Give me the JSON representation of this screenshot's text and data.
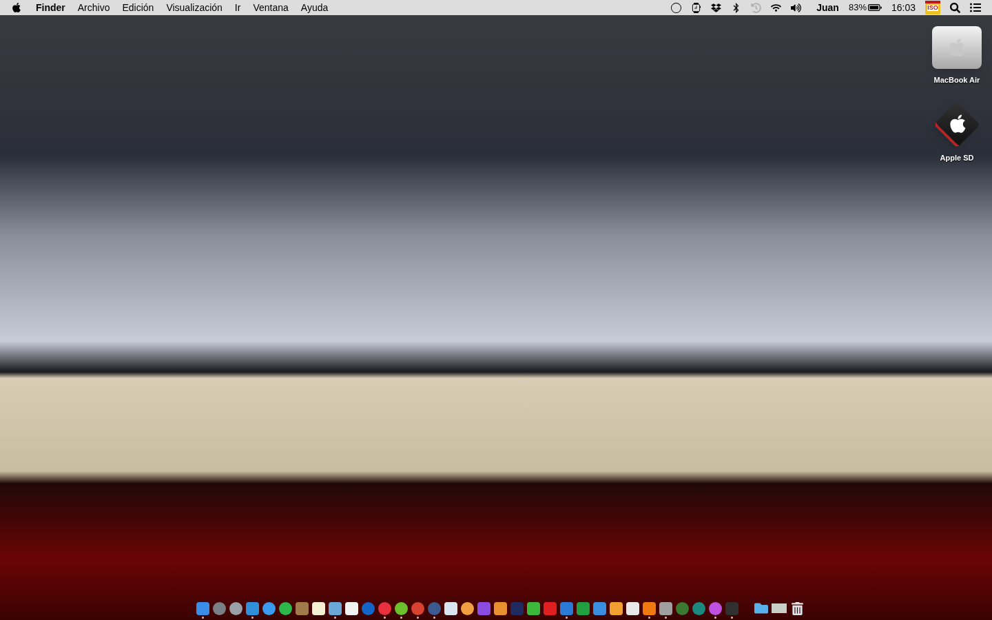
{
  "menu_bar": {
    "app_name": "Finder",
    "menus": [
      "Archivo",
      "Edición",
      "Visualización",
      "Ir",
      "Ventana",
      "Ayuda"
    ],
    "status_items": [
      {
        "kind": "circle",
        "dimmed": false
      },
      {
        "kind": "watch",
        "dimmed": false
      },
      {
        "kind": "dropbox",
        "dimmed": false
      },
      {
        "kind": "bluetooth",
        "dimmed": false
      },
      {
        "kind": "history",
        "dimmed": true
      },
      {
        "kind": "wifi",
        "dimmed": false
      },
      {
        "kind": "volume",
        "dimmed": false
      }
    ],
    "user": "Juan",
    "battery_percent": "83%",
    "clock": "16:03",
    "input_source": "ISO"
  },
  "desktop_icons": [
    {
      "kind": "drive",
      "label": "MacBook Air"
    },
    {
      "kind": "sd",
      "label": "Apple SD"
    }
  ],
  "dock": {
    "apps": [
      {
        "kind": "square",
        "color": "#3b8ee8",
        "running": true
      },
      {
        "kind": "circle",
        "color": "#7a7f85",
        "running": false
      },
      {
        "kind": "circle",
        "color": "#9aa0a8",
        "running": false
      },
      {
        "kind": "square",
        "color": "#2f8fd8",
        "running": true
      },
      {
        "kind": "circle",
        "color": "#3a9af0",
        "running": false
      },
      {
        "kind": "circle",
        "color": "#2cb84a",
        "running": false
      },
      {
        "kind": "square",
        "color": "#a07a48",
        "running": false
      },
      {
        "kind": "square",
        "color": "#f4efd0",
        "running": false
      },
      {
        "kind": "square",
        "color": "#6aa8d8",
        "running": true
      },
      {
        "kind": "square",
        "color": "#f2f2f2",
        "running": false
      },
      {
        "kind": "circle",
        "color": "#1465c8",
        "running": false
      },
      {
        "kind": "circle",
        "color": "#e8303e",
        "running": true
      },
      {
        "kind": "circle",
        "color": "#6cc02c",
        "running": true
      },
      {
        "kind": "circle",
        "color": "#d84030",
        "running": true
      },
      {
        "kind": "circle",
        "color": "#3b5a90",
        "running": true
      },
      {
        "kind": "square",
        "color": "#d8e4f0",
        "running": false
      },
      {
        "kind": "circle",
        "color": "#f0a040",
        "running": false
      },
      {
        "kind": "square",
        "color": "#8a4ce0",
        "running": false
      },
      {
        "kind": "square",
        "color": "#e89030",
        "running": false
      },
      {
        "kind": "square",
        "color": "#1e2a60",
        "running": false
      },
      {
        "kind": "square",
        "color": "#3cb83c",
        "running": false
      },
      {
        "kind": "square",
        "color": "#e02020",
        "running": false
      },
      {
        "kind": "square",
        "color": "#2a7ad8",
        "running": true
      },
      {
        "kind": "square",
        "color": "#20a040",
        "running": false
      },
      {
        "kind": "square",
        "color": "#3a8ee0",
        "running": false
      },
      {
        "kind": "square",
        "color": "#f0a030",
        "running": false
      },
      {
        "kind": "square",
        "color": "#e8e8e8",
        "running": false
      },
      {
        "kind": "square",
        "color": "#f07a10",
        "running": true
      },
      {
        "kind": "square",
        "color": "#a0a0a0",
        "running": true
      },
      {
        "kind": "circle",
        "color": "#3a7a30",
        "running": false
      },
      {
        "kind": "circle",
        "color": "#1a8a80",
        "running": false
      },
      {
        "kind": "circle",
        "color": "#c050e0",
        "running": true
      },
      {
        "kind": "square",
        "color": "#303030",
        "running": true
      }
    ],
    "stacks": [
      {
        "kind": "folder",
        "color": "#5ab0e8"
      },
      {
        "kind": "stack",
        "color": "#c8d0c8"
      },
      {
        "kind": "trash",
        "color": "#e0e4e8"
      }
    ]
  }
}
